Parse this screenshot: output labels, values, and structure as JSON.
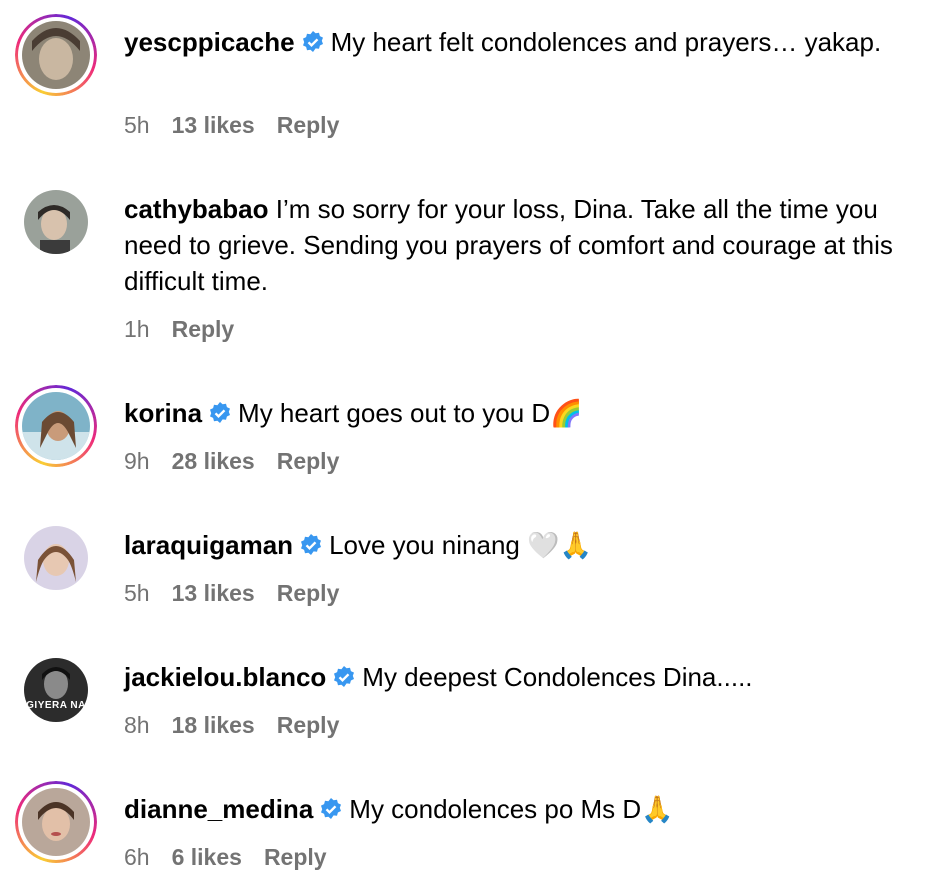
{
  "comments": [
    {
      "username": "yescppicache",
      "verified": true,
      "text": "My heart felt condolences and prayers… yakap.",
      "time": "5h",
      "likes": "13 likes",
      "reply": "Reply",
      "story_ring": true
    },
    {
      "username": "cathybabao",
      "verified": false,
      "text": "I’m so sorry for your loss, Dina. Take all the time you need to grieve. Sending you prayers of comfort and courage at this difficult time.",
      "time": "1h",
      "likes": "",
      "reply": "Reply",
      "story_ring": false
    },
    {
      "username": "korina",
      "verified": true,
      "text": "My heart goes out to you D🌈",
      "time": "9h",
      "likes": "28 likes",
      "reply": "Reply",
      "story_ring": true
    },
    {
      "username": "laraquigaman",
      "verified": true,
      "text": "Love you ninang 🤍🙏",
      "time": "5h",
      "likes": "13 likes",
      "reply": "Reply",
      "story_ring": false
    },
    {
      "username": "jackielou.blanco",
      "verified": true,
      "text": "My deepest Condolences Dina.....",
      "time": "8h",
      "likes": "18 likes",
      "reply": "Reply",
      "story_ring": false,
      "avatar_text": "GIYERA NA"
    },
    {
      "username": "dianne_medina",
      "verified": true,
      "text": "My condolences po Ms D🙏",
      "time": "6h",
      "likes": "6 likes",
      "reply": "Reply",
      "story_ring": true
    }
  ],
  "colors": {
    "verified": "#3897f0",
    "meta": "#737373"
  }
}
